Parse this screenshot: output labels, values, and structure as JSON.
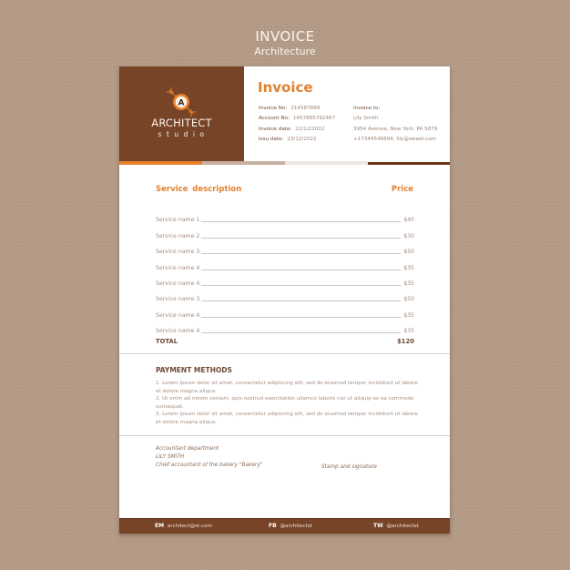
{
  "hero": {
    "title": "INVOICE",
    "subtitle": "Architecture"
  },
  "brand": {
    "logo_letter": "A",
    "name": "ARCHITECT",
    "tagline": "studio",
    "colors": {
      "panel": "#774428",
      "accent": "#e2812f"
    }
  },
  "invoice": {
    "title": "Invoice",
    "meta": [
      {
        "label": "Invoice No:",
        "value": "214587889"
      },
      {
        "label": "Account No:",
        "value": "1457885792467"
      },
      {
        "label": "Invoice date:",
        "value": "22/12/2022"
      },
      {
        "label": "Issu date:",
        "value": "23/12/2022"
      }
    ],
    "bill_to": {
      "label": "Invoice to:",
      "name": "Lily Smith",
      "address": "3954 Avenue, New York, PA 5879",
      "contact": "+17344546894,  lily@sweet.com"
    }
  },
  "services": {
    "description_header": "Service  description",
    "price_header": "Price",
    "items": [
      {
        "name": "Service name 1",
        "price": "$40"
      },
      {
        "name": "Service name 2",
        "price": "$30"
      },
      {
        "name": "Service name 3",
        "price": "$50"
      },
      {
        "name": "Service name 4",
        "price": "$35"
      },
      {
        "name": "Service name 4",
        "price": "$35"
      },
      {
        "name": "Service name 3",
        "price": "$50"
      },
      {
        "name": "Service name 4",
        "price": "$35"
      },
      {
        "name": "Service name 4",
        "price": "$35"
      }
    ],
    "total_label": "TOTAL",
    "total_value": "$120"
  },
  "payment": {
    "heading": "PAYMENT METHODS",
    "items": [
      "1.  Lorem ipsum dolor sit amet, consectetur adipiscing elit, sed do eiusmod tempor incididunt ut labore et dolore magna aliqua.",
      "2.  Ut enim ad minim veniam, quis nostrud exercitation ullamco laboris nisi ut aliquip ex ea commodo consequat.",
      "3.  Lorem ipsum dolor sit amet, consectetur adipiscing elit, sed do eiusmod tempor incididunt ut labore et dolore magna aliqua."
    ]
  },
  "signature": {
    "department": "Accountant department",
    "name": "LILY SMITH",
    "role": "Chief accountant of the bakery \"Bakery\"",
    "stamp_label": "Stamp and signature"
  },
  "footer": {
    "email_label": "EM",
    "email": "architect@st.com",
    "fb_label": "FB",
    "fb": "@architectst",
    "tw_label": "TW",
    "tw": "@architectst"
  }
}
